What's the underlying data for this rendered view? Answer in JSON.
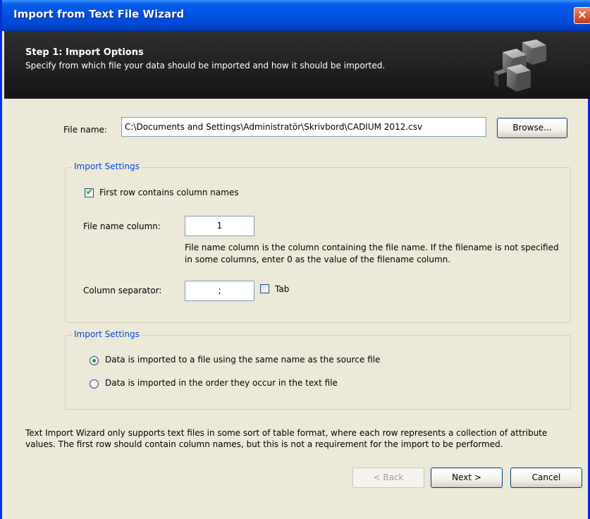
{
  "window": {
    "title": "Import from Text File Wizard",
    "close_glyph": "×",
    "accent_color": "#0054e3"
  },
  "header": {
    "step_title": "Step 1: Import Options",
    "step_description": "Specify from which file your data should be imported and how it should be imported.",
    "icon": "cube-stack-icon"
  },
  "file": {
    "label": "File name:",
    "value": "C:\\Documents and Settings\\Administratör\\Skrivbord\\CADIUM 2012.csv",
    "browse_label": "Browse..."
  },
  "import_settings_1": {
    "legend": "Import Settings",
    "first_row_checkbox": {
      "label": "First row contains column names",
      "checked": true
    },
    "file_name_column": {
      "label": "File name column:",
      "value": "1",
      "help": "File name column is the column containing the file name. If the filename is not specified in some columns, enter 0 as the value of the filename column."
    },
    "column_separator": {
      "label": "Column separator:",
      "value": ";",
      "tab_label": "Tab",
      "tab_checked": false
    }
  },
  "import_settings_2": {
    "legend": "Import Settings",
    "options": [
      {
        "label": "Data is imported to a file using the same name as the source file",
        "selected": true
      },
      {
        "label": "Data is imported in the order they occur in the text file",
        "selected": false
      }
    ]
  },
  "footer": {
    "note": "Text Import Wizard only supports text files in some sort of table format, where each row represents a collection of attribute values. The first row should contain column names, but this is not a requirement for the import to be performed.",
    "back_label": "< Back",
    "next_label": "Next >",
    "cancel_label": "Cancel"
  }
}
